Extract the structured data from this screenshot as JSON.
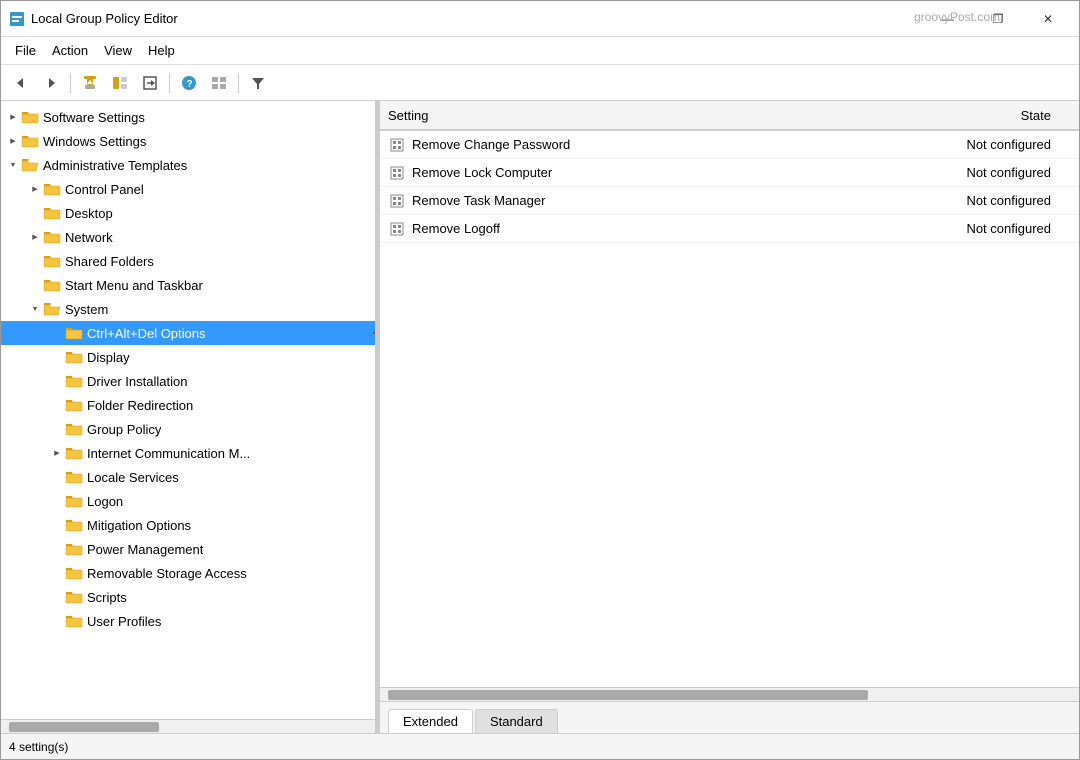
{
  "window": {
    "title": "Local Group Policy Editor",
    "watermark": "groovyPost.com"
  },
  "titlebar": {
    "minimize": "—",
    "maximize": "❐",
    "close": "✕"
  },
  "menu": {
    "items": [
      "File",
      "Action",
      "View",
      "Help"
    ]
  },
  "toolbar": {
    "buttons": [
      "←",
      "→",
      "⬆",
      "📋",
      "📤",
      "❓",
      "🖥",
      "▼"
    ]
  },
  "tree": {
    "items": [
      {
        "id": "software-settings",
        "label": "Software Settings",
        "indent": 0,
        "expand": "collapsed",
        "level": 1
      },
      {
        "id": "windows-settings",
        "label": "Windows Settings",
        "indent": 0,
        "expand": "collapsed",
        "level": 1
      },
      {
        "id": "admin-templates",
        "label": "Administrative Templates",
        "indent": 0,
        "expand": "expanded",
        "level": 1
      },
      {
        "id": "control-panel",
        "label": "Control Panel",
        "indent": 1,
        "expand": "collapsed",
        "level": 2
      },
      {
        "id": "desktop",
        "label": "Desktop",
        "indent": 1,
        "expand": "leaf",
        "level": 2
      },
      {
        "id": "network",
        "label": "Network",
        "indent": 1,
        "expand": "collapsed",
        "level": 2
      },
      {
        "id": "shared-folders",
        "label": "Shared Folders",
        "indent": 1,
        "expand": "leaf",
        "level": 2
      },
      {
        "id": "start-menu-taskbar",
        "label": "Start Menu and Taskbar",
        "indent": 1,
        "expand": "leaf",
        "level": 2
      },
      {
        "id": "system",
        "label": "System",
        "indent": 1,
        "expand": "expanded",
        "level": 2
      },
      {
        "id": "ctrl-alt-del",
        "label": "Ctrl+Alt+Del Options",
        "indent": 2,
        "expand": "leaf",
        "level": 3,
        "selected": true
      },
      {
        "id": "display",
        "label": "Display",
        "indent": 2,
        "expand": "leaf",
        "level": 3
      },
      {
        "id": "driver-installation",
        "label": "Driver Installation",
        "indent": 2,
        "expand": "leaf",
        "level": 3
      },
      {
        "id": "folder-redirection",
        "label": "Folder Redirection",
        "indent": 2,
        "expand": "leaf",
        "level": 3
      },
      {
        "id": "group-policy",
        "label": "Group Policy",
        "indent": 2,
        "expand": "leaf",
        "level": 3
      },
      {
        "id": "internet-comm",
        "label": "Internet Communication M...",
        "indent": 2,
        "expand": "collapsed",
        "level": 3
      },
      {
        "id": "locale-services",
        "label": "Locale Services",
        "indent": 2,
        "expand": "leaf",
        "level": 3
      },
      {
        "id": "logon",
        "label": "Logon",
        "indent": 2,
        "expand": "leaf",
        "level": 3
      },
      {
        "id": "mitigation-options",
        "label": "Mitigation Options",
        "indent": 2,
        "expand": "leaf",
        "level": 3
      },
      {
        "id": "power-management",
        "label": "Power Management",
        "indent": 2,
        "expand": "leaf",
        "level": 3
      },
      {
        "id": "removable-storage",
        "label": "Removable Storage Access",
        "indent": 2,
        "expand": "leaf",
        "level": 3
      },
      {
        "id": "scripts",
        "label": "Scripts",
        "indent": 2,
        "expand": "leaf",
        "level": 3
      },
      {
        "id": "user-profiles",
        "label": "User Profiles",
        "indent": 2,
        "expand": "leaf",
        "level": 3
      }
    ]
  },
  "list_header": {
    "setting": "Setting",
    "state": "State"
  },
  "list_rows": [
    {
      "id": "row1",
      "name": "Remove Change Password",
      "state": "Not configured"
    },
    {
      "id": "row2",
      "name": "Remove Lock Computer",
      "state": "Not configured"
    },
    {
      "id": "row3",
      "name": "Remove Task Manager",
      "state": "Not configured"
    },
    {
      "id": "row4",
      "name": "Remove Logoff",
      "state": "Not configured"
    }
  ],
  "tabs": [
    {
      "id": "extended",
      "label": "Extended",
      "active": true
    },
    {
      "id": "standard",
      "label": "Standard",
      "active": false
    }
  ],
  "status_bar": {
    "text": "4 setting(s)"
  }
}
